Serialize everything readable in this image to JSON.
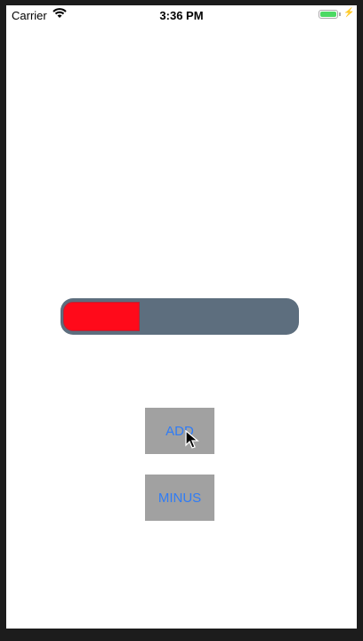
{
  "status_bar": {
    "carrier": "Carrier",
    "time": "3:36 PM",
    "battery_level": 1.0,
    "battery_color": "#4cd964"
  },
  "progress": {
    "value": 0.33,
    "fill_color": "#ff0a1a",
    "track_color": "#5d6e7e"
  },
  "buttons": {
    "add": "ADD",
    "minus": "MINUS"
  }
}
